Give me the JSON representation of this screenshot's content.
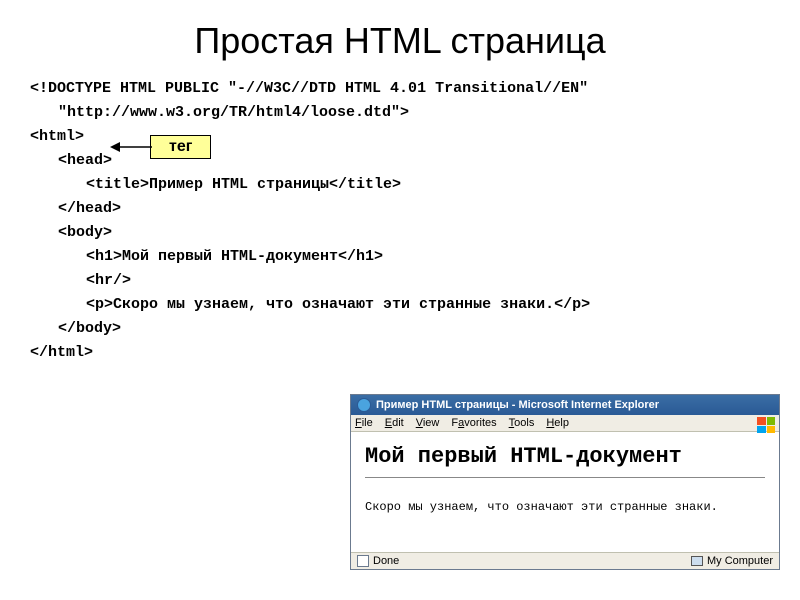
{
  "title": "Простая HTML страница",
  "callout": "тег",
  "code": {
    "doctype": "<!DOCTYPE HTML PUBLIC \"-//W3C//DTD HTML 4.01 Transitional//EN\" \"http://www.w3.org/TR/html4/loose.dtd\">",
    "html_open": "<html>",
    "head_open": "<head>",
    "title_line": "<title>Пример HTML страницы</title>",
    "head_close": "</head>",
    "body_open": "<body>",
    "h1_line": "<h1>Мой первый HTML-документ</h1>",
    "hr_line": "<hr/>",
    "p_line": "<p>Скоро мы узнаем, что означают эти странные знаки.</p>",
    "body_close": "</body>",
    "html_close": "</html>"
  },
  "browser": {
    "title": "Пример HTML страницы - Microsoft Internet Explorer",
    "menu": {
      "file": "File",
      "edit": "Edit",
      "view": "View",
      "favorites": "Favorites",
      "tools": "Tools",
      "help": "Help"
    },
    "content": {
      "h1": "Мой первый HTML-документ",
      "p": "Скоро мы узнаем, что означают эти странные знаки."
    },
    "status": {
      "done": "Done",
      "zone": "My Computer"
    }
  }
}
